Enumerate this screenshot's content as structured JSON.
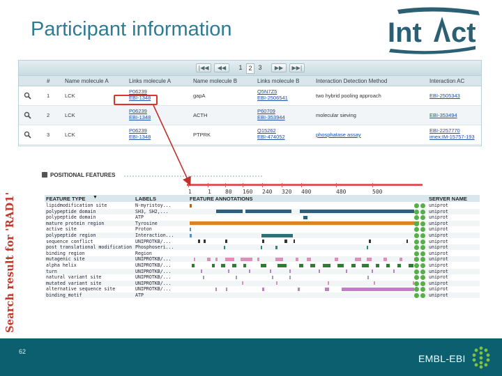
{
  "slide": {
    "title": "Participant information",
    "side_caption": "Search result for 'RAD1'",
    "page_number": "62",
    "footer_brand": "EMBL-EBI"
  },
  "logo": {
    "text_in": "Int",
    "text_act": "ct"
  },
  "interaction_table": {
    "pager": {
      "first": "|◀◀",
      "prev": "◀◀",
      "pages": [
        "1",
        "2",
        "3"
      ],
      "active_page": "2",
      "next": "▶▶",
      "last": "▶▶|"
    },
    "columns": [
      "#",
      "Name molecule A",
      "Links molecule A",
      "Name molecule B",
      "Links molecule B",
      "Interaction Detection Method",
      "Interaction AC"
    ],
    "rows": [
      {
        "num": "1",
        "name_a": "LCK",
        "links_a": [
          "P06239",
          "EBI-1348"
        ],
        "name_b": "gapA",
        "links_b": [
          "Q5N7Z5",
          "EBI-2506541"
        ],
        "method": "two hybrid pooling approach",
        "ac": [
          "EBI-2505343"
        ]
      },
      {
        "num": "2",
        "name_a": "LCK",
        "links_a": [
          "P06239",
          "EBI-1348"
        ],
        "name_b": "ACTH",
        "links_b": [
          "P60709",
          "EBI-353944"
        ],
        "method": "molecular sieving",
        "ac": [
          "EBI-353494"
        ]
      },
      {
        "num": "3",
        "name_a": "LCK",
        "links_a": [
          "P06239",
          "EBI-1348"
        ],
        "name_b": "PTPRK",
        "links_b": [
          "Q15262",
          "EBI-474052"
        ],
        "method": "phosphatase assay",
        "ac": [
          "EBI-2257770",
          "imex:IM-15757-193"
        ]
      }
    ]
  },
  "features": {
    "panel_title": "POSITIONAL FEATURES",
    "scale_ticks": [
      "1",
      "1",
      "80",
      "160",
      "240",
      "320",
      "400",
      "480",
      "500"
    ],
    "headers": {
      "type": "FEATURE TYPE",
      "labels": "LABELS",
      "annotations": "FEATURE ANNOTATIONS",
      "server": "SERVER NAME"
    },
    "rows": [
      {
        "type": "lipidmodification site",
        "label": "N-myristoy...",
        "server": "uniprot",
        "segs": [
          [
            1,
            5,
            "#b5651d"
          ]
        ]
      },
      {
        "type": "polypeptide domain",
        "label": "SH3, SH2,...",
        "server": "uniprot",
        "segs": [
          [
            60,
            118,
            "#2f5f7a"
          ],
          [
            124,
            226,
            "#2f5f7a"
          ],
          [
            245,
            498,
            "#2f5f7a"
          ]
        ]
      },
      {
        "type": "polypeptide domain",
        "label": "ATP",
        "server": "uniprot",
        "segs": [
          [
            252,
            262,
            "#2f5f7a"
          ]
        ]
      },
      {
        "type": "mature protein region",
        "label": "Tyrosine",
        "server": "uniprot",
        "segs": [
          [
            1,
            509,
            "#d6852b"
          ]
        ]
      },
      {
        "type": "active site",
        "label": "Proton",
        "server": "uniprot",
        "segs": [
          [
            1,
            4,
            "#5b8fb8"
          ]
        ]
      },
      {
        "type": "polypeptide region",
        "label": "Interaction...",
        "server": "uniprot",
        "segs": [
          [
            1,
            5,
            "#5b8fb8"
          ],
          [
            160,
            230,
            "#2e6f78"
          ]
        ]
      },
      {
        "type": "sequence conflict",
        "label": "UNIPROTKB/...",
        "server": "uniprot",
        "segs": [
          [
            20,
            24,
            "#333"
          ],
          [
            32,
            36,
            "#333"
          ],
          [
            80,
            84,
            "#333"
          ],
          [
            162,
            166,
            "#333"
          ],
          [
            211,
            217,
            "#333"
          ],
          [
            230,
            234,
            "#333"
          ],
          [
            398,
            402,
            "#333"
          ],
          [
            480,
            484,
            "#333"
          ]
        ]
      },
      {
        "type": "post translational modification",
        "label": "Phosphoseri...",
        "server": "uniprot",
        "segs": [
          [
            76,
            80,
            "#2a8a6a"
          ],
          [
            158,
            161,
            "#2a8a6a"
          ],
          [
            191,
            195,
            "#2a8a6a"
          ],
          [
            392,
            395,
            "#2a8a6a"
          ],
          [
            503,
            506,
            "#2a8a6a"
          ]
        ]
      },
      {
        "type": "binding region",
        "label": "Region",
        "server": "uniprot",
        "segs": []
      },
      {
        "type": "mutagenic site",
        "label": "UNIPROTKB/...",
        "server": "uniprot",
        "segs": [
          [
            10,
            14,
            "#e08fb8"
          ],
          [
            40,
            48,
            "#e08fb8"
          ],
          [
            58,
            62,
            "#e08fb8"
          ],
          [
            80,
            100,
            "#e08fb8"
          ],
          [
            113,
            140,
            "#e08fb8"
          ],
          [
            150,
            156,
            "#e08fb8"
          ],
          [
            190,
            208,
            "#e08fb8"
          ],
          [
            236,
            242,
            "#e08fb8"
          ],
          [
            260,
            270,
            "#e08fb8"
          ],
          [
            322,
            330,
            "#e08fb8"
          ],
          [
            366,
            380,
            "#e08fb8"
          ],
          [
            393,
            403,
            "#e08fb8"
          ],
          [
            430,
            437,
            "#e08fb8"
          ],
          [
            465,
            472,
            "#e08fb8"
          ],
          [
            498,
            504,
            "#e08fb8"
          ]
        ]
      },
      {
        "type": "alpha helix",
        "label": "UNIPROTKB/...",
        "server": "uniprot",
        "segs": [
          [
            6,
            12,
            "#2e7d32"
          ],
          [
            50,
            56,
            "#2e7d32"
          ],
          [
            71,
            79,
            "#2e7d32"
          ],
          [
            95,
            105,
            "#2e7d32"
          ],
          [
            120,
            126,
            "#2e7d32"
          ],
          [
            158,
            170,
            "#2e7d32"
          ],
          [
            195,
            215,
            "#2e7d32"
          ],
          [
            243,
            253,
            "#2e7d32"
          ],
          [
            268,
            278,
            "#2e7d32"
          ],
          [
            296,
            312,
            "#2e7d32"
          ],
          [
            328,
            342,
            "#2e7d32"
          ],
          [
            358,
            368,
            "#2e7d32"
          ],
          [
            382,
            398,
            "#2e7d32"
          ],
          [
            412,
            420,
            "#2e7d32"
          ],
          [
            436,
            444,
            "#2e7d32"
          ],
          [
            460,
            468,
            "#2e7d32"
          ],
          [
            486,
            496,
            "#2e7d32"
          ]
        ]
      },
      {
        "type": "turn",
        "label": "UNIPROTKB/...",
        "server": "uniprot",
        "segs": [
          [
            25,
            28,
            "#c07fc4"
          ],
          [
            86,
            89,
            "#c07fc4"
          ],
          [
            132,
            135,
            "#c07fc4"
          ],
          [
            178,
            181,
            "#c07fc4"
          ],
          [
            222,
            225,
            "#c07fc4"
          ],
          [
            286,
            289,
            "#c07fc4"
          ],
          [
            346,
            349,
            "#c07fc4"
          ],
          [
            404,
            407,
            "#c07fc4"
          ],
          [
            451,
            454,
            "#c07fc4"
          ]
        ]
      },
      {
        "type": "natural variant site",
        "label": "UNIPROTKB/...",
        "server": "uniprot",
        "segs": [
          [
            31,
            33,
            "#9aa0a6"
          ],
          [
            102,
            104,
            "#9aa0a6"
          ],
          [
            183,
            185,
            "#9aa0a6"
          ],
          [
            222,
            224,
            "#9aa0a6"
          ],
          [
            395,
            397,
            "#9aa0a6"
          ]
        ]
      },
      {
        "type": "mutated variant site",
        "label": "UNIPROTKB/...",
        "server": "uniprot",
        "segs": [
          [
            116,
            118,
            "#e08fb8"
          ],
          [
            192,
            196,
            "#e08fb8"
          ],
          [
            306,
            309,
            "#e08fb8"
          ],
          [
            408,
            412,
            "#e08fb8"
          ],
          [
            494,
            497,
            "#e08fb8"
          ]
        ]
      },
      {
        "type": "alternative sequence site",
        "label": "UNIPROTKB/...",
        "server": "uniprot",
        "segs": [
          [
            58,
            61,
            "#c07fc4"
          ],
          [
            81,
            84,
            "#c07fc4"
          ],
          [
            162,
            166,
            "#c07fc4"
          ],
          [
            240,
            244,
            "#c07fc4"
          ],
          [
            300,
            309,
            "#c07fc4"
          ],
          [
            337,
            498,
            "#c07fc4"
          ]
        ]
      },
      {
        "type": "binding_motif",
        "label": "ATP",
        "server": "uniprot",
        "segs": []
      }
    ],
    "seq_length": 509
  }
}
